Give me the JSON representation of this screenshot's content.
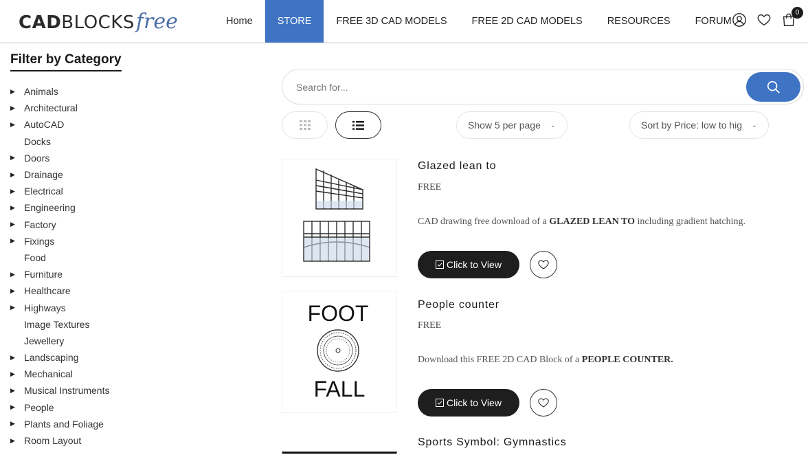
{
  "logo": {
    "main_bold": "CAD",
    "main_light": "BLOCKS",
    "script": "free"
  },
  "nav": [
    {
      "label": "Home",
      "active": false
    },
    {
      "label": "STORE",
      "active": true
    },
    {
      "label": "FREE 3D CAD MODELS",
      "active": false
    },
    {
      "label": "FREE 2D CAD MODELS",
      "active": false
    },
    {
      "label": "RESOURCES",
      "active": false
    },
    {
      "label": "FORUM",
      "active": false
    }
  ],
  "header_icons": {
    "account": "user-icon",
    "wishlist": "heart-icon",
    "cart": "shopping-bag-icon",
    "cart_count": "0"
  },
  "sidebar": {
    "title": "Filter by Category",
    "categories": [
      {
        "label": "Animals",
        "expandable": true
      },
      {
        "label": "Architectural",
        "expandable": true
      },
      {
        "label": "AutoCAD",
        "expandable": true
      },
      {
        "label": "Docks",
        "expandable": false
      },
      {
        "label": "Doors",
        "expandable": true
      },
      {
        "label": "Drainage",
        "expandable": true
      },
      {
        "label": "Electrical",
        "expandable": true
      },
      {
        "label": "Engineering",
        "expandable": true
      },
      {
        "label": "Factory",
        "expandable": true
      },
      {
        "label": "Fixings",
        "expandable": true
      },
      {
        "label": "Food",
        "expandable": false
      },
      {
        "label": "Furniture",
        "expandable": true
      },
      {
        "label": "Healthcare",
        "expandable": true
      },
      {
        "label": "Highways",
        "expandable": true
      },
      {
        "label": "Image Textures",
        "expandable": false
      },
      {
        "label": "Jewellery",
        "expandable": false
      },
      {
        "label": "Landscaping",
        "expandable": true
      },
      {
        "label": "Mechanical",
        "expandable": true
      },
      {
        "label": "Musical Instruments",
        "expandable": true
      },
      {
        "label": "People",
        "expandable": true
      },
      {
        "label": "Plants and Foliage",
        "expandable": true
      },
      {
        "label": "Room Layout",
        "expandable": true
      }
    ]
  },
  "search": {
    "placeholder": "Search for...",
    "value": ""
  },
  "toolbar": {
    "per_page": "Show 5 per page",
    "sort": "Sort by Price: low to hig"
  },
  "products": [
    {
      "title": "Glazed lean to",
      "price": "FREE",
      "desc_pre": "CAD drawing free download of a ",
      "desc_bold": "GLAZED LEAN TO",
      "desc_post": " including gradient hatching.",
      "button": "Click to View"
    },
    {
      "title": "People counter",
      "price": "FREE",
      "desc_pre": "Download this FREE 2D CAD Block of a ",
      "desc_bold": "PEOPLE COUNTER.",
      "desc_post": "",
      "button": "Click to View",
      "thumb_text_top": "FOOT",
      "thumb_text_bottom": "FALL"
    },
    {
      "title": "Sports Symbol: Gymnastics"
    }
  ]
}
